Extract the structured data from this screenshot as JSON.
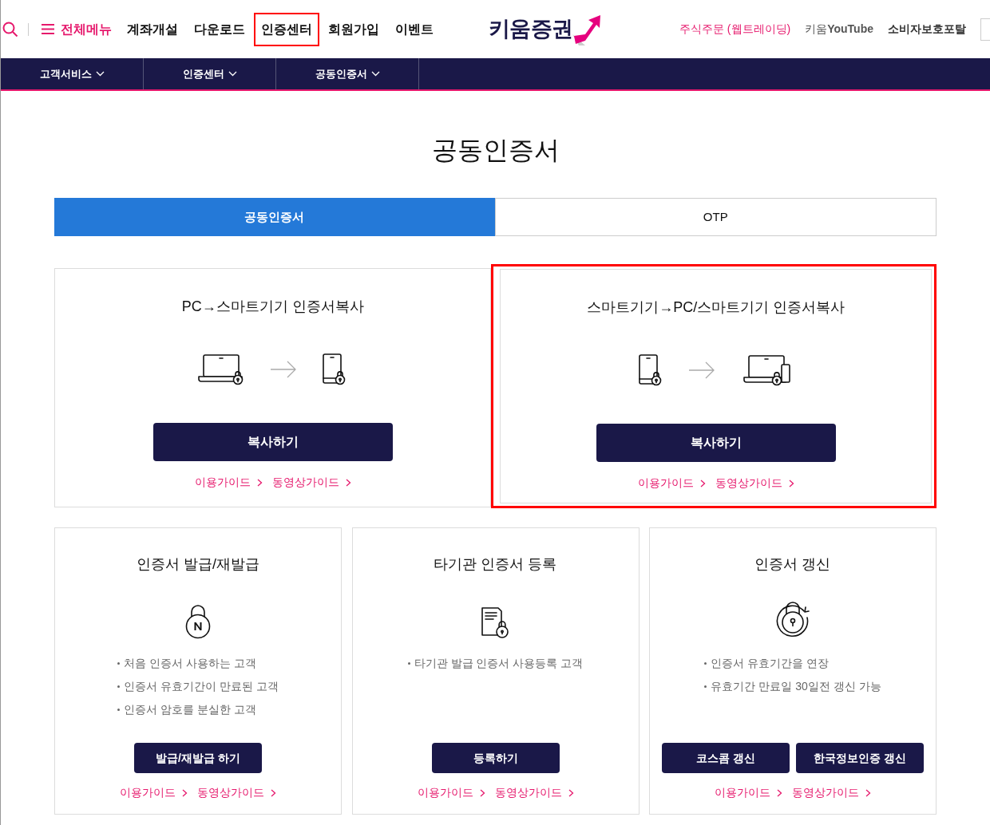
{
  "header": {
    "menu": {
      "label": "전체메뉴"
    },
    "nav": [
      {
        "label": "계좌개설",
        "highlighted": false
      },
      {
        "label": "다운로드",
        "highlighted": false
      },
      {
        "label": "인증센터",
        "highlighted": true
      },
      {
        "label": "회원가입",
        "highlighted": false
      },
      {
        "label": "이벤트",
        "highlighted": false
      }
    ],
    "logo": {
      "text": "키움증권"
    },
    "utility_links": [
      {
        "label": "주식주문 (웹트레이딩)",
        "kind": "accent"
      },
      {
        "label": "키움**YouTube**",
        "kind": "muted"
      },
      {
        "label": "소비자보호포탈",
        "kind": "bold"
      }
    ]
  },
  "subnav": [
    {
      "label": "고객서비스"
    },
    {
      "label": "인증센터"
    },
    {
      "label": "공동인증서"
    }
  ],
  "page_title": "공동인증서",
  "tabs": [
    {
      "label": "공동인증서",
      "selected": true
    },
    {
      "label": "OTP",
      "selected": false
    }
  ],
  "copy_cards": [
    {
      "title": "PC→스마트기기 인증서복사",
      "kind": "pc-to-phone",
      "highlighted": false,
      "button": "복사하기",
      "links": [
        "이용가이드",
        "동영상가이드"
      ]
    },
    {
      "title": "스마트기기→PC/스마트기기 인증서복사",
      "kind": "phone-to-pc",
      "highlighted": true,
      "button": "복사하기",
      "links": [
        "이용가이드",
        "동영상가이드"
      ]
    }
  ],
  "service_cards": [
    {
      "title": "인증서 발급/재발급",
      "kind": "issue",
      "bullets": [
        "처음 인증서 사용하는 고객",
        "인증서 유효기간이 만료된 고객",
        "인증서 암호를 분실한 고객"
      ],
      "buttons": [
        "발급/재발급 하기"
      ],
      "links": [
        "이용가이드",
        "동영상가이드"
      ]
    },
    {
      "title": "타기관 인증서 등록",
      "kind": "register",
      "bullets": [
        "타기관 발급 인증서 사용등록 고객"
      ],
      "buttons": [
        "등록하기"
      ],
      "links": [
        "이용가이드",
        "동영상가이드"
      ]
    },
    {
      "title": "인증서 갱신",
      "kind": "renew",
      "bullets": [
        "인증서 유효기간을 연장",
        "유효기간 만료일 30일전 갱신 가능"
      ],
      "buttons": [
        "코스콤 갱신",
        "한국정보인증 갱신"
      ],
      "links": [
        "이용가이드",
        "동영상가이드"
      ]
    }
  ]
}
